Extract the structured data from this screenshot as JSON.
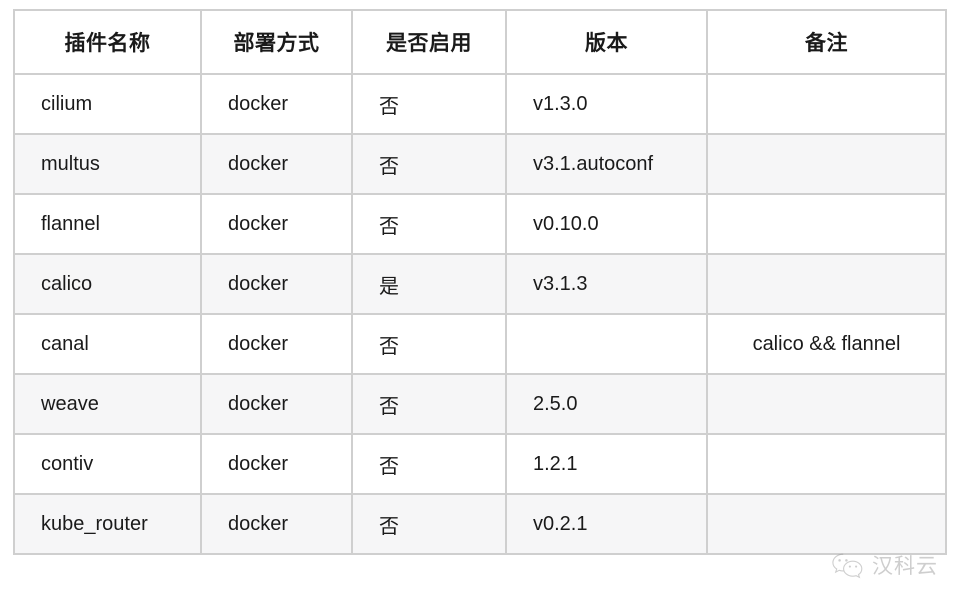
{
  "table": {
    "headers": [
      "插件名称",
      "部署方式",
      "是否启用",
      "版本",
      "备注"
    ],
    "rows": [
      {
        "name": "cilium",
        "deploy": "docker",
        "enabled": "否",
        "version": "v1.3.0",
        "note": ""
      },
      {
        "name": "multus",
        "deploy": "docker",
        "enabled": "否",
        "version": "v3.1.autoconf",
        "note": ""
      },
      {
        "name": "flannel",
        "deploy": "docker",
        "enabled": "否",
        "version": "v0.10.0",
        "note": ""
      },
      {
        "name": "calico",
        "deploy": "docker",
        "enabled": "是",
        "version": "v3.1.3",
        "note": ""
      },
      {
        "name": "canal",
        "deploy": "docker",
        "enabled": "否",
        "version": "",
        "note": "calico && flannel"
      },
      {
        "name": "weave",
        "deploy": "docker",
        "enabled": "否",
        "version": "2.5.0",
        "note": ""
      },
      {
        "name": "contiv",
        "deploy": "docker",
        "enabled": "否",
        "version": "1.2.1",
        "note": ""
      },
      {
        "name": "kube_router",
        "deploy": "docker",
        "enabled": "否",
        "version": "v0.2.1",
        "note": ""
      }
    ]
  },
  "watermark": {
    "icon": "wechat-icon",
    "text": "汉科云",
    "color": "#8c8c8c"
  },
  "colors": {
    "border": "#cfcfcf",
    "row_alt_background": "#f6f6f7",
    "row_background": "#ffffff",
    "text": "#1a1a1a"
  }
}
